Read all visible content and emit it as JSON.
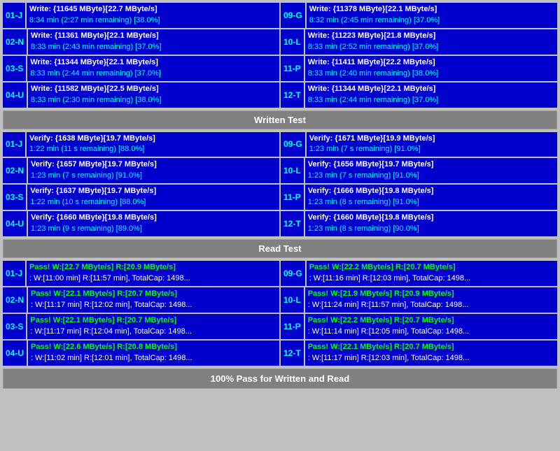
{
  "sections": {
    "write_test": {
      "label": "Written Test",
      "rows": [
        {
          "left": {
            "id": "01-J",
            "line1": "Write: {11645 MByte}[22.7 MByte/s]",
            "line2": "8:34 min (2:27 min remaining)  [38.0%]"
          },
          "right": {
            "id": "09-G",
            "line1": "Write: {11378 MByte}[22.1 MByte/s]",
            "line2": "8:32 min (2:45 min remaining)  [37.0%]"
          }
        },
        {
          "left": {
            "id": "02-N",
            "line1": "Write: {11361 MByte}[22.1 MByte/s]",
            "line2": "8:33 min (2:43 min remaining)  [37.0%]"
          },
          "right": {
            "id": "10-L",
            "line1": "Write: {11223 MByte}[21.8 MByte/s]",
            "line2": "8:33 min (2:52 min remaining)  [37.0%]"
          }
        },
        {
          "left": {
            "id": "03-S",
            "line1": "Write: {11344 MByte}[22.1 MByte/s]",
            "line2": "8:33 min (2:44 min remaining)  [37.0%]"
          },
          "right": {
            "id": "11-P",
            "line1": "Write: {11411 MByte}[22.2 MByte/s]",
            "line2": "8:33 min (2:40 min remaining)  [38.0%]"
          }
        },
        {
          "left": {
            "id": "04-U",
            "line1": "Write: {11582 MByte}[22.5 MByte/s]",
            "line2": "8:33 min (2:30 min remaining)  [38.0%]"
          },
          "right": {
            "id": "12-T",
            "line1": "Write: {11344 MByte}[22.1 MByte/s]",
            "line2": "8:33 min (2:44 min remaining)  [37.0%]"
          }
        }
      ]
    },
    "verify_test": {
      "label": "Written Test",
      "rows": [
        {
          "left": {
            "id": "01-J",
            "line1": "Verify: {1638 MByte}[19.7 MByte/s]",
            "line2": "1:22 min (11 s remaining)   [88.0%]"
          },
          "right": {
            "id": "09-G",
            "line1": "Verify: {1671 MByte}[19.9 MByte/s]",
            "line2": "1:23 min (7 s remaining)   [91.0%]"
          }
        },
        {
          "left": {
            "id": "02-N",
            "line1": "Verify: {1657 MByte}[19.7 MByte/s]",
            "line2": "1:23 min (7 s remaining)   [91.0%]"
          },
          "right": {
            "id": "10-L",
            "line1": "Verify: {1656 MByte}[19.7 MByte/s]",
            "line2": "1:23 min (7 s remaining)   [91.0%]"
          }
        },
        {
          "left": {
            "id": "03-S",
            "line1": "Verify: {1637 MByte}[19.7 MByte/s]",
            "line2": "1:22 min (10 s remaining)   [88.0%]"
          },
          "right": {
            "id": "11-P",
            "line1": "Verify: {1666 MByte}[19.8 MByte/s]",
            "line2": "1:23 min (8 s remaining)   [91.0%]"
          }
        },
        {
          "left": {
            "id": "04-U",
            "line1": "Verify: {1660 MByte}[19.8 MByte/s]",
            "line2": "1:23 min (9 s remaining)   [89.0%]"
          },
          "right": {
            "id": "12-T",
            "line1": "Verify: {1660 MByte}[19.8 MByte/s]",
            "line2": "1:23 min (8 s remaining)   [90.0%]"
          }
        }
      ]
    },
    "read_test": {
      "label": "Read Test",
      "rows": [
        {
          "left": {
            "id": "01-J",
            "line1": "Pass! W:[22.7 MByte/s] R:[20.9 MByte/s]",
            "line2": ": W:[11:00 min] R:[11:57 min], TotalCap: 1498..."
          },
          "right": {
            "id": "09-G",
            "line1": "Pass! W:[22.2 MByte/s] R:[20.7 MByte/s]",
            "line2": ": W:[11:16 min] R:[12:03 min], TotalCap: 1498..."
          }
        },
        {
          "left": {
            "id": "02-N",
            "line1": "Pass! W:[22.1 MByte/s] R:[20.7 MByte/s]",
            "line2": ": W:[11:17 min] R:[12:02 min], TotalCap: 1498..."
          },
          "right": {
            "id": "10-L",
            "line1": "Pass! W:[21.9 MByte/s] R:[20.9 MByte/s]",
            "line2": ": W:[11:24 min] R:[11:57 min], TotalCap: 1498..."
          }
        },
        {
          "left": {
            "id": "03-S",
            "line1": "Pass! W:[22.1 MByte/s] R:[20.7 MByte/s]",
            "line2": ": W:[11:17 min] R:[12:04 min], TotalCap: 1498..."
          },
          "right": {
            "id": "11-P",
            "line1": "Pass! W:[22.2 MByte/s] R:[20.7 MByte/s]",
            "line2": ": W:[11:14 min] R:[12:05 min], TotalCap: 1498..."
          }
        },
        {
          "left": {
            "id": "04-U",
            "line1": "Pass! W:[22.6 MByte/s] R:[20.8 MByte/s]",
            "line2": ": W:[11:02 min] R:[12:01 min], TotalCap: 1498..."
          },
          "right": {
            "id": "12-T",
            "line1": "Pass! W:[22.1 MByte/s] R:[20.7 MByte/s]",
            "line2": ": W:[11:17 min] R:[12:03 min], TotalCap: 1498..."
          }
        }
      ]
    }
  },
  "dividers": {
    "written_test": "Written Test",
    "read_test": "Read Test"
  },
  "bottom_bar": "100% Pass for Written and Read"
}
